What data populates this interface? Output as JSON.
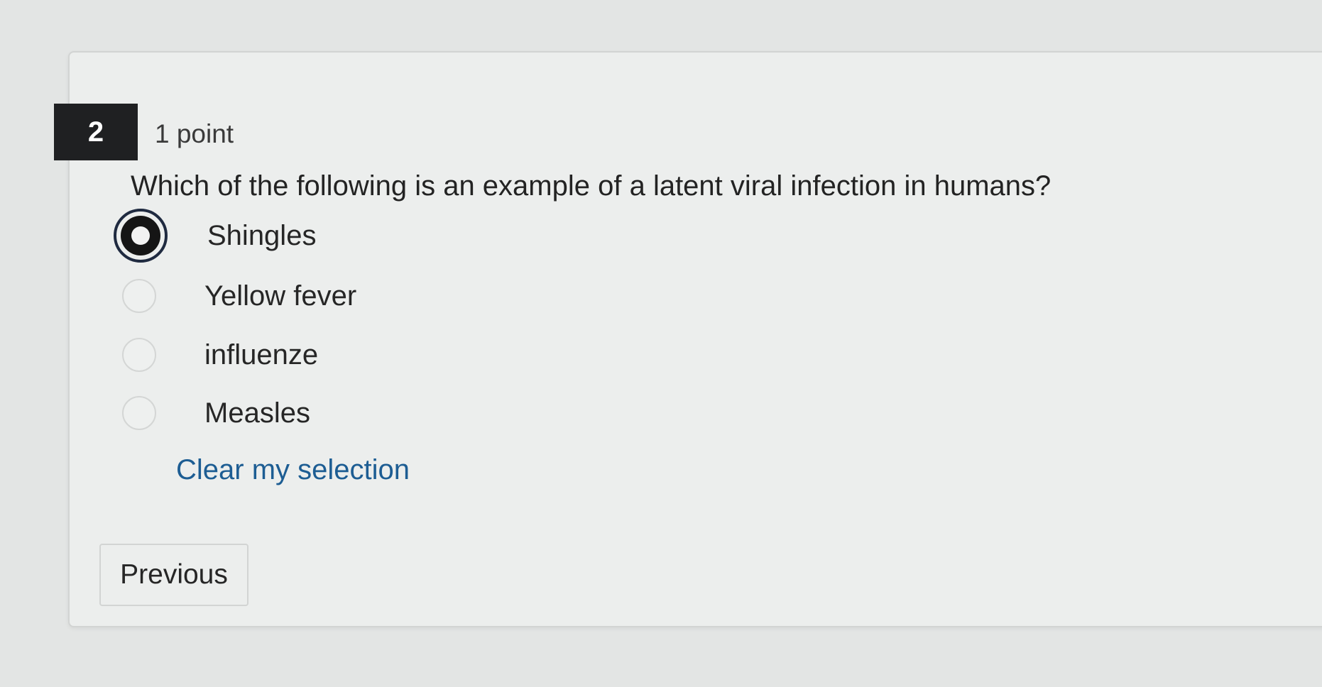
{
  "question": {
    "number": "2",
    "points": "1 point",
    "text": "Which of the following is an example of a latent viral infection in humans?",
    "options": [
      {
        "label": "Shingles",
        "selected": true
      },
      {
        "label": "Yellow fever",
        "selected": false
      },
      {
        "label": "influenze",
        "selected": false
      },
      {
        "label": "Measles",
        "selected": false
      }
    ],
    "clear_label": "Clear my selection"
  },
  "navigation": {
    "previous_label": "Previous"
  },
  "colors": {
    "link": "#1d5d93",
    "question_badge": "#1f2022",
    "selected_radio_ring": "#1f2a40"
  }
}
